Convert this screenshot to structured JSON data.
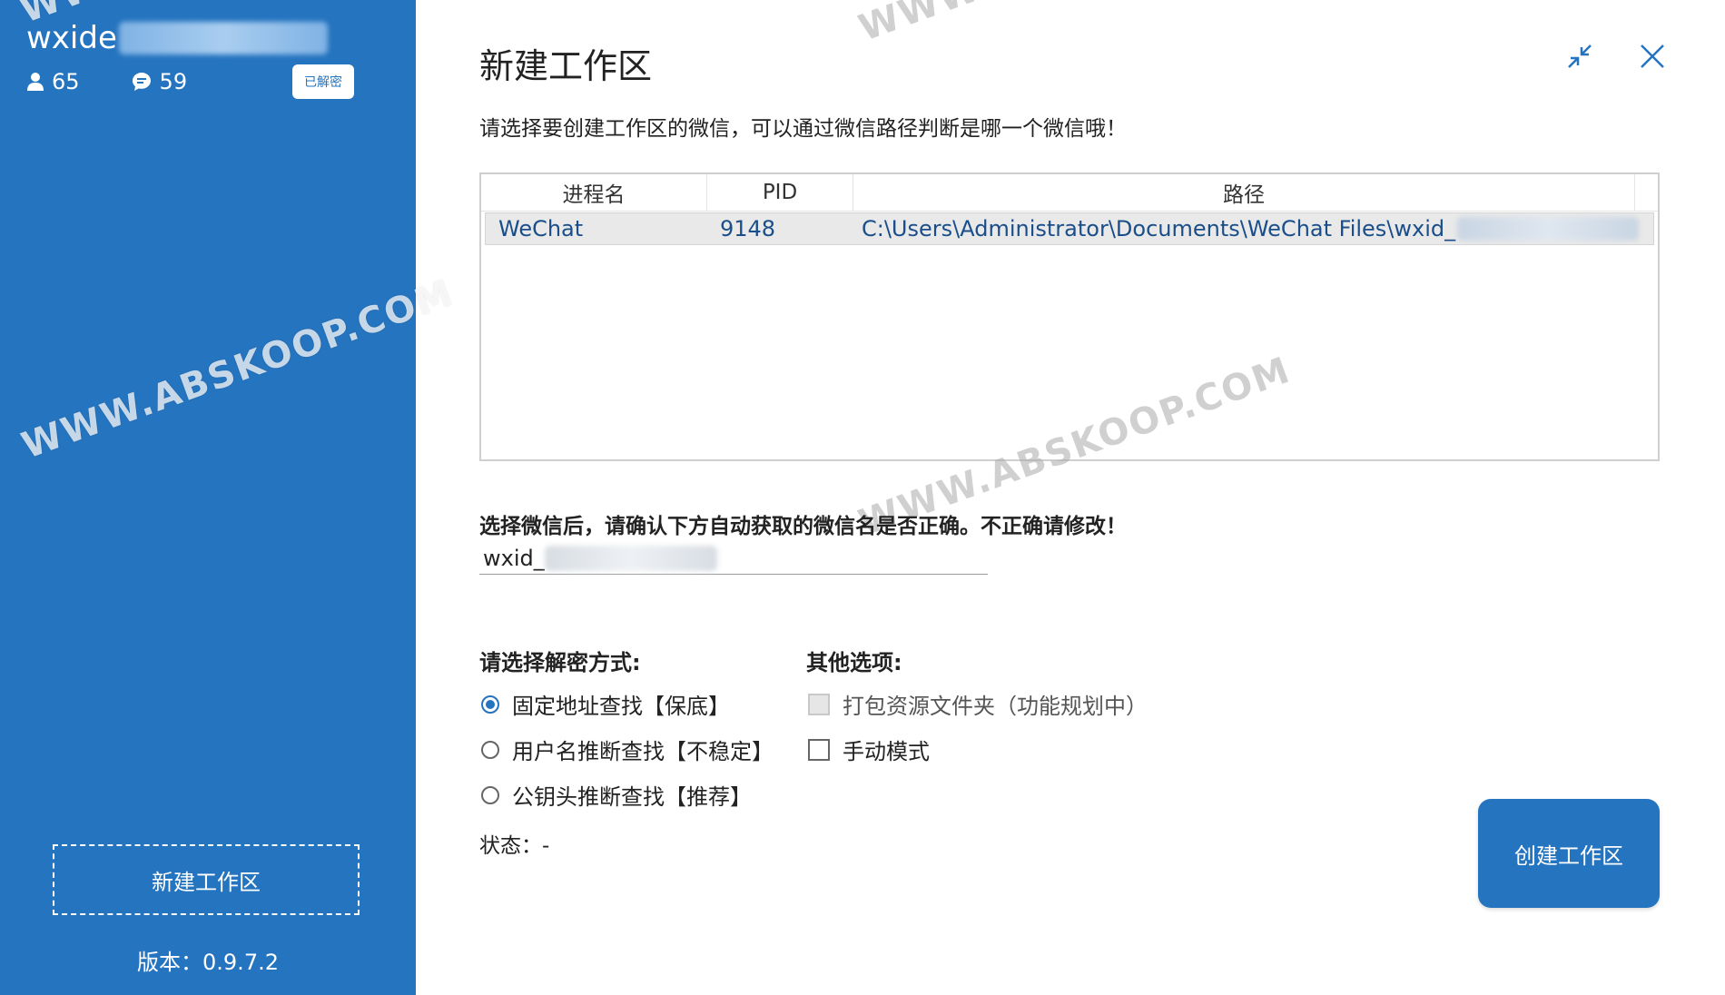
{
  "sidebar": {
    "username_visible": "wxide",
    "friends_count": "65",
    "chats_count": "59",
    "badge_label": "已解密",
    "new_workspace_label": "新建工作区",
    "version_label": "版本：",
    "version_value": "0.9.7.2"
  },
  "dialog": {
    "title": "新建工作区",
    "subtitle": "请选择要创建工作区的微信，可以通过微信路径判断是哪一个微信哦！",
    "table": {
      "headers": [
        "进程名",
        "PID",
        "路径"
      ],
      "rows": [
        {
          "process": "WeChat",
          "pid": "9148",
          "path": "C:\\Users\\Administrator\\Documents\\WeChat Files\\wxid_"
        }
      ]
    },
    "confirm_label": "选择微信后，请确认下方自动获取的微信名是否正确。不正确请修改！",
    "wechat_name_prefix": "wxid_",
    "decrypt_section_label": "请选择解密方式:",
    "decrypt_options": [
      {
        "label": "固定地址查找【保底】",
        "checked": true
      },
      {
        "label": "用户名推断查找【不稳定】",
        "checked": false
      },
      {
        "label": "公钥头推断查找【推荐】",
        "checked": false
      }
    ],
    "other_section_label": "其他选项:",
    "other_options": [
      {
        "label": "打包资源文件夹（功能规划中）",
        "checked": false,
        "disabled": true
      },
      {
        "label": "手动模式",
        "checked": false,
        "disabled": false
      }
    ],
    "status_label": "状态：",
    "status_value": "-",
    "create_button_label": "创建工作区"
  },
  "watermark_text": "WWW.ABSKOOP.COM",
  "colors": {
    "accent": "#2574bf",
    "background": "#ffffff"
  }
}
